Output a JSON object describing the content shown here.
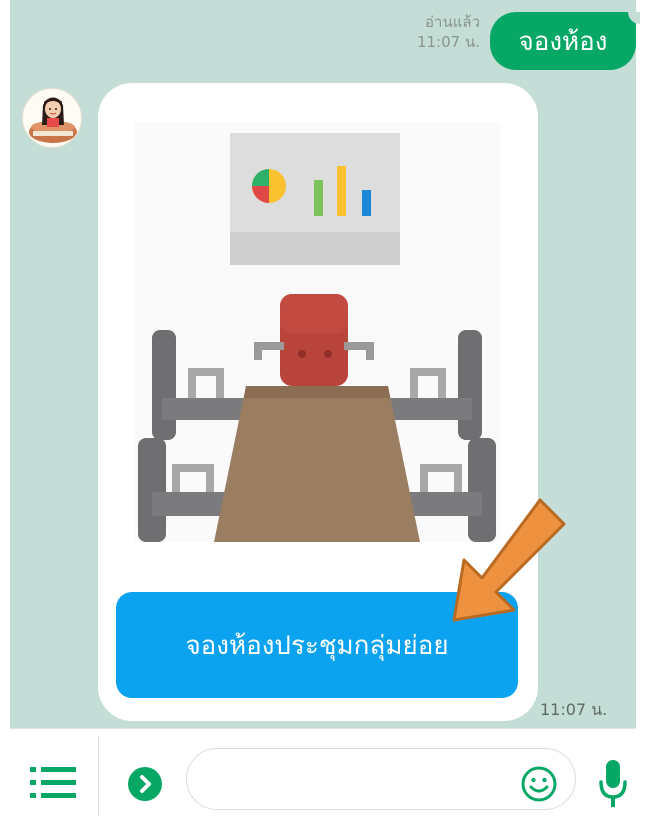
{
  "chat": {
    "user_message": "จองห้อง",
    "read_status": "อ่านแล้ว",
    "user_time": "11:07 น.",
    "bot_time": "11:07 น."
  },
  "card": {
    "image_icon": "meeting-room-icon",
    "button_label": "จองห้องประชุมกลุ่มย่อย"
  },
  "input_bar": {
    "placeholder": "",
    "menu_icon": "list-menu-icon",
    "expand_icon": "chevron-right-icon",
    "emoji_icon": "emoji-icon",
    "mic_icon": "microphone-icon"
  },
  "colors": {
    "chat_background": "#c4ddd6",
    "user_bubble": "#07a865",
    "card_button": "#0ba2f0",
    "highlight_arrow": "#ef9240"
  }
}
